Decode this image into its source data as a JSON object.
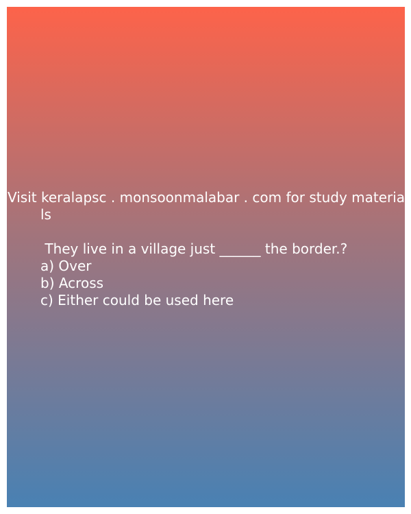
{
  "banner": {
    "line1": "Visit keralapsc . monsoonmalabar . com for study materia",
    "line2": "ls"
  },
  "question": {
    "text": " They live in a village just ______ the border.?",
    "options": [
      "a) Over",
      "b) Across",
      "c) Either could be used here"
    ]
  },
  "colors": {
    "gradient_top": "#fd634a",
    "gradient_bottom": "#4981b3",
    "text": "#ffffff"
  }
}
